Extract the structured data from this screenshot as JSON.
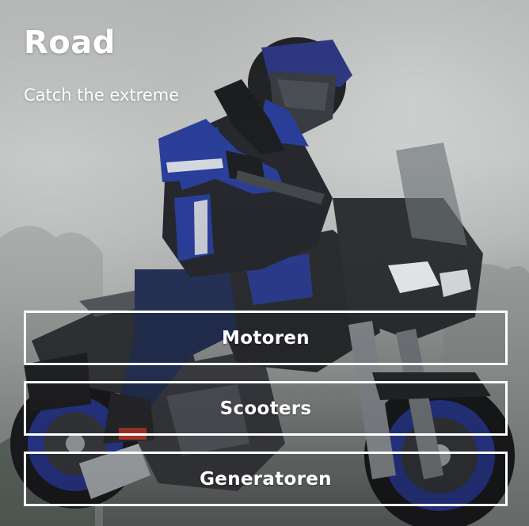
{
  "hero": {
    "title": "Road",
    "subtitle": "Catch the extreme",
    "image": "motorcyclist-riding-sport-touring-motorcycle-in-fog"
  },
  "nav": {
    "items": [
      {
        "label": "Motoren"
      },
      {
        "label": "Scooters"
      },
      {
        "label": "Generatoren"
      }
    ]
  },
  "colors": {
    "text": "#ffffff",
    "button_border": "#ffffff",
    "fog": "#c2c5c4",
    "jacket_blue": "#2a3f9a",
    "bike_dark": "#2b2d30"
  }
}
